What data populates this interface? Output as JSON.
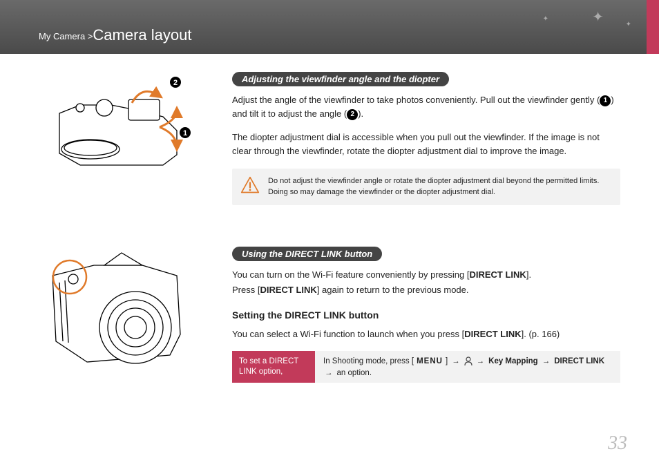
{
  "breadcrumb": {
    "parent": "My Camera",
    "sep": ">",
    "current": "Camera layout"
  },
  "page_number": "33",
  "callout1": "1",
  "callout2": "2",
  "section1": {
    "heading": "Adjusting the viewfinder angle and the diopter",
    "p1a": "Adjust the angle of the viewfinder to take photos conveniently. Pull out the viewfinder gently (",
    "p1b": ") and tilt it to adjust the angle (",
    "p1c": ").",
    "p2": "The diopter adjustment dial is accessible when you pull out the viewfinder. If the image is not clear through the viewfinder, rotate the diopter adjustment dial to improve the image.",
    "note": "Do not adjust the viewfinder angle or rotate the diopter adjustment dial beyond the permitted limits. Doing so may damage the viewfinder or the diopter adjustment dial."
  },
  "section2": {
    "heading": "Using the DIRECT LINK button",
    "p1a": "You can turn on the Wi-Fi feature conveniently by pressing [",
    "direct_link": "DIRECT LINK",
    "p1b": "].",
    "p2a": "Press [",
    "p2b": "] again to return to the previous mode.",
    "sub_heading": "Setting the DIRECT LINK button",
    "p3a": "You can select a Wi-Fi function to launch when you press [",
    "p3b": "]. (p. 166)",
    "proc_label": "To set a DIRECT LINK option,",
    "proc_a": "In Shooting mode, press [",
    "menu": "MENU",
    "proc_b": "]",
    "arrow": "→",
    "key_mapping": "Key Mapping",
    "option_text": "an option."
  }
}
